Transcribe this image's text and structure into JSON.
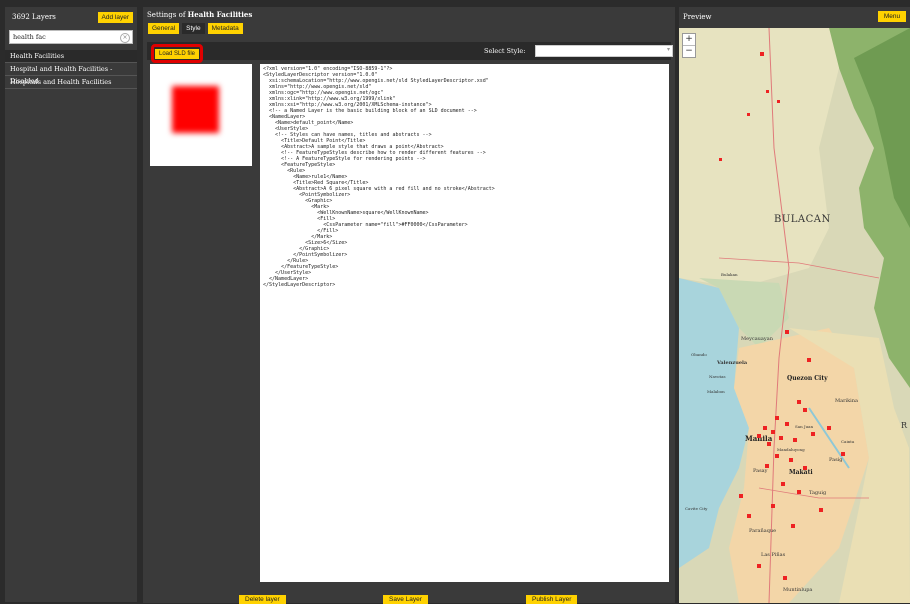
{
  "left_panel": {
    "layer_count": "3692 Layers",
    "add_layer_label": "Add layer",
    "search_value": "health fac",
    "layers": [
      {
        "label": "Health Facilities",
        "active": true
      },
      {
        "label": "Hospital and Health Facilities - Disabled",
        "active": false
      },
      {
        "label": "Hospitals and Health Facilities",
        "active": false
      }
    ]
  },
  "settings": {
    "title_prefix": "Settings of ",
    "layer_name": "Health Facilities",
    "tabs": [
      {
        "label": "General",
        "active": false
      },
      {
        "label": "Style",
        "active": true
      },
      {
        "label": "Metadata",
        "active": false
      }
    ],
    "load_sld_label": "Load SLD file",
    "select_style_label": "Select Style:",
    "select_style_value": "",
    "sld_xml": "<?xml version=\"1.0\" encoding=\"ISO-8859-1\"?>\n<StyledLayerDescriptor version=\"1.0.0\"\n  xsi:schemaLocation=\"http://www.opengis.net/sld StyledLayerDescriptor.xsd\"\n  xmlns=\"http://www.opengis.net/sld\"\n  xmlns:ogc=\"http://www.opengis.net/ogc\"\n  xmlns:xlink=\"http://www.w3.org/1999/xlink\"\n  xmlns:xsi=\"http://www.w3.org/2001/XMLSchema-instance\">\n  <!-- a Named Layer is the basic building block of an SLD document -->\n  <NamedLayer>\n    <Name>default_point</Name>\n    <UserStyle>\n    <!-- Styles can have names, titles and abstracts -->\n      <Title>Default Point</Title>\n      <Abstract>A sample style that draws a point</Abstract>\n      <!-- FeatureTypeStyles describe how to render different features -->\n      <!-- A FeatureTypeStyle for rendering points -->\n      <FeatureTypeStyle>\n        <Rule>\n          <Name>rule1</Name>\n          <Title>Red Square</Title>\n          <Abstract>A 6 pixel square with a red fill and no stroke</Abstract>\n            <PointSymbolizer>\n              <Graphic>\n                <Mark>\n                  <WellKnownName>square</WellKnownName>\n                  <Fill>\n                    <CssParameter name=\"fill\">#FF0000</CssParameter>\n                  </Fill>\n                </Mark>\n              <Size>6</Size>\n            </Graphic>\n          </PointSymbolizer>\n        </Rule>\n      </FeatureTypeStyle>\n    </UserStyle>\n  </NamedLayer>\n</StyledLayerDescriptor>",
    "preview_fill": "#ff0000",
    "bottom_buttons": {
      "delete": "Delete layer",
      "save": "Save Layer",
      "publish": "Publish Layer"
    }
  },
  "preview_panel": {
    "title": "Preview",
    "menu_label": "Menu",
    "zoom_in": "+",
    "zoom_out": "−",
    "map_labels": {
      "province": "BULACAN",
      "valenzuela": "Valenzuela",
      "quezon_city": "Quezon City",
      "malabon": "Malabon",
      "marikina": "Marikina",
      "manila": "Manila",
      "san_juan": "San Juan",
      "mandaluyong": "Mandaluyong",
      "pasig": "Pasig",
      "pasay": "Pasay",
      "makati": "Makati",
      "taguig": "Taguig",
      "paranaque": "Parañaque",
      "las_pinas": "Las Piñas",
      "muntinlupa": "Muntinlupa",
      "cavite_city": "Cavite City",
      "meycauayan": "Meycauayan",
      "navotas": "Navotas",
      "obando": "Obando",
      "cainta": "Cainta",
      "bulakan": "Bulakan",
      "r_edge": "R"
    }
  },
  "colors": {
    "accent_yellow": "#ffd200",
    "highlight_red": "#e00000",
    "panel_bg": "#3a3a3a",
    "marker_red": "#ee2222"
  }
}
